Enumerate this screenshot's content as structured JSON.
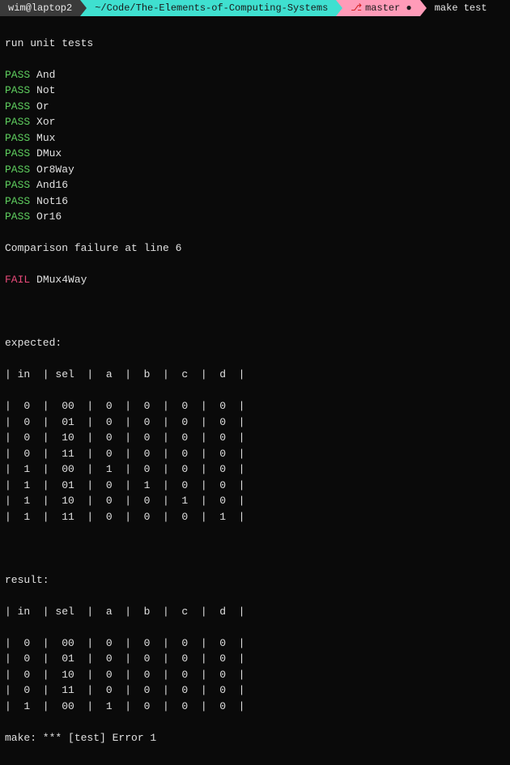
{
  "statusline": {
    "user": "wim@laptop2",
    "path": "~/Code/The-Elements-of-Computing-Systems",
    "branch": "master",
    "dirty": "●",
    "command": "make test"
  },
  "intro": "run unit tests",
  "pass_label": "PASS",
  "fail_label": "FAIL",
  "tests": {
    "pass": [
      "And",
      "Not",
      "Or",
      "Xor",
      "Mux",
      "DMux",
      "Or8Way",
      "And16",
      "Not16",
      "Or16"
    ],
    "failure_msg": "Comparison failure at line 6",
    "fail_name": "DMux4Way"
  },
  "expected": {
    "title": "expected:",
    "header": "| in  | sel  |  a  |  b  |  c  |  d  |",
    "rows": [
      "|  0  |  00  |  0  |  0  |  0  |  0  |",
      "|  0  |  01  |  0  |  0  |  0  |  0  |",
      "|  0  |  10  |  0  |  0  |  0  |  0  |",
      "|  0  |  11  |  0  |  0  |  0  |  0  |",
      "|  1  |  00  |  1  |  0  |  0  |  0  |",
      "|  1  |  01  |  0  |  1  |  0  |  0  |",
      "|  1  |  10  |  0  |  0  |  1  |  0  |",
      "|  1  |  11  |  0  |  0  |  0  |  1  |"
    ]
  },
  "result": {
    "title": "result:",
    "header": "| in  | sel  |  a  |  b  |  c  |  d  |",
    "rows": [
      "|  0  |  00  |  0  |  0  |  0  |  0  |",
      "|  0  |  01  |  0  |  0  |  0  |  0  |",
      "|  0  |  10  |  0  |  0  |  0  |  0  |",
      "|  0  |  11  |  0  |  0  |  0  |  0  |",
      "|  1  |  00  |  1  |  0  |  0  |  0  |"
    ]
  },
  "make_error": "make: *** [test] Error 1"
}
